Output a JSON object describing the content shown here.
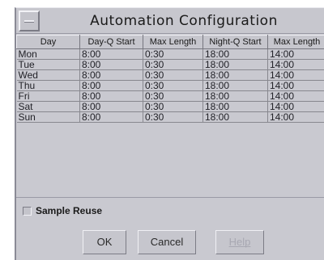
{
  "window": {
    "title": "Automation Configuration"
  },
  "table": {
    "columns": [
      "Day",
      "Day-Q Start",
      "Max Length",
      "Night-Q Start",
      "Max Length"
    ],
    "rows": [
      [
        "Mon",
        "8:00",
        "0:30",
        "18:00",
        "14:00"
      ],
      [
        "Tue",
        "8:00",
        "0:30",
        "18:00",
        "14:00"
      ],
      [
        "Wed",
        "8:00",
        "0:30",
        "18:00",
        "14:00"
      ],
      [
        "Thu",
        "8:00",
        "0:30",
        "18:00",
        "14:00"
      ],
      [
        "Fri",
        "8:00",
        "0:30",
        "18:00",
        "14:00"
      ],
      [
        "Sat",
        "8:00",
        "0:30",
        "18:00",
        "14:00"
      ],
      [
        "Sun",
        "8:00",
        "0:30",
        "18:00",
        "14:00"
      ]
    ]
  },
  "options": {
    "sample_reuse_label": "Sample Reuse",
    "sample_reuse_checked": false
  },
  "buttons": {
    "ok": "OK",
    "cancel": "Cancel",
    "help": "Help",
    "help_enabled": false
  }
}
